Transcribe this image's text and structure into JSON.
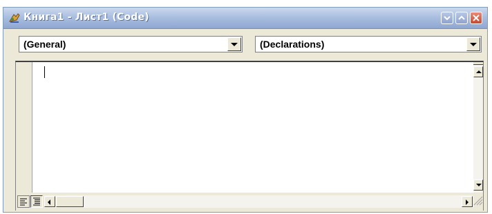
{
  "window": {
    "title": "Книга1 - Лист1 (Code)",
    "title_icon": "vba-code-window-icon",
    "controls": [
      "minimize-icon",
      "maximize-icon",
      "close-icon"
    ]
  },
  "object_combo": {
    "selected": "(General)"
  },
  "procedure_combo": {
    "selected": "(Declarations)"
  },
  "editor": {
    "content": ""
  },
  "bottom_bar": {
    "view_buttons": [
      "procedure-view-icon",
      "full-module-view-icon"
    ]
  },
  "colors": {
    "titlebar_start": "#ccd9ed",
    "titlebar_end": "#8fa7d1",
    "close_button": "#c9482e",
    "chrome": "#ece9d8",
    "editor_background": "#ffffff"
  }
}
